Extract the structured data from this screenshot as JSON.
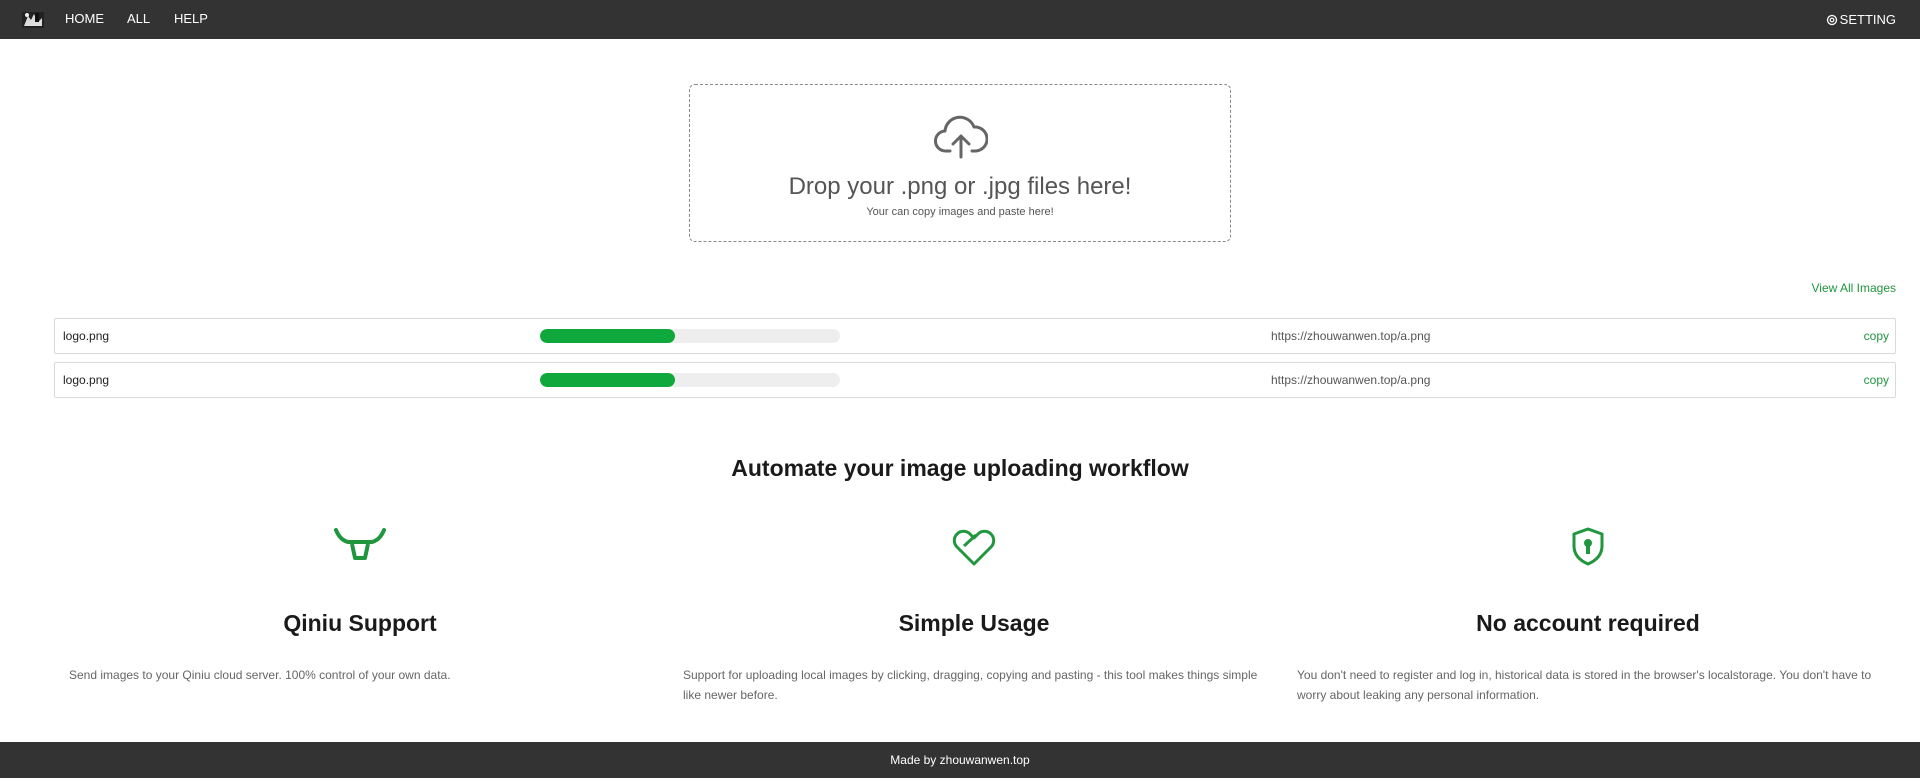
{
  "nav": {
    "home": "HOME",
    "all": "ALL",
    "help": "HELP",
    "setting": "SETTING"
  },
  "upload": {
    "icon": "cloud-upload-icon",
    "title": "Drop your .png or .jpg files here!",
    "subtitle": "Your can copy images and paste here!"
  },
  "view_all": "View All Images",
  "files": [
    {
      "name": "logo.png",
      "progress": 0.45,
      "url": "https://zhouwanwen.top/a.png",
      "copy": "copy"
    },
    {
      "name": "logo.png",
      "progress": 0.45,
      "url": "https://zhouwanwen.top/a.png",
      "copy": "copy"
    }
  ],
  "headline": "Automate your image uploading workflow",
  "features": [
    {
      "icon": "bull-horns-icon",
      "title": "Qiniu Support",
      "desc": "Send images to your Qiniu cloud server. 100% control of your own data."
    },
    {
      "icon": "heart-icon",
      "title": "Simple Usage",
      "desc": "Support for uploading local images by clicking, dragging, copying and pasting - this tool makes things simple like newer before."
    },
    {
      "icon": "shield-lock-icon",
      "title": "No account required",
      "desc": "You don't need to register and log in, historical data is stored in the browser's localstorage. You don't have to worry about leaking any personal information."
    }
  ],
  "footer": "Made by zhouwanwen.top",
  "colors": {
    "topbar": "#333333",
    "accent": "#20963e",
    "progress": "#0fa83d"
  }
}
